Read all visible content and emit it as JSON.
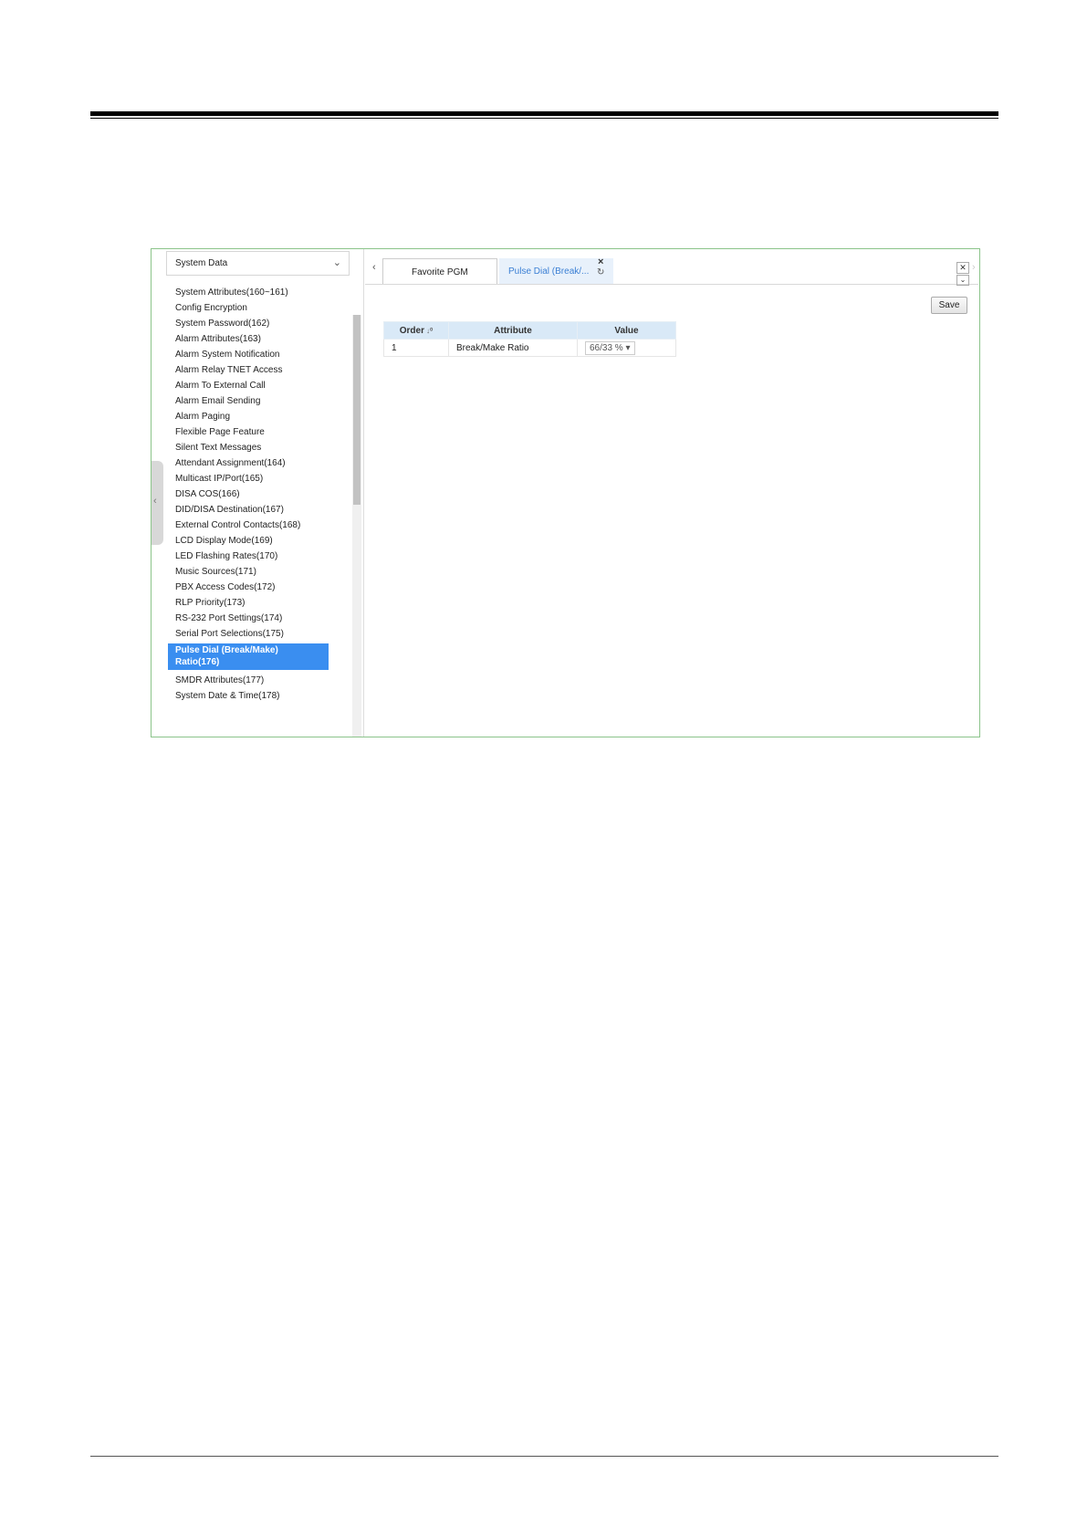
{
  "sidebar": {
    "dropdown_label": "System Data",
    "items": [
      "System Attributes(160~161)",
      "Config Encryption",
      "System Password(162)",
      "Alarm Attributes(163)",
      "Alarm System Notification",
      "Alarm Relay TNET Access",
      "Alarm To External Call",
      "Alarm Email Sending",
      "Alarm Paging",
      "Flexible Page Feature",
      "Silent Text Messages",
      "Attendant Assignment(164)",
      "Multicast IP/Port(165)",
      "DISA COS(166)",
      "DID/DISA Destination(167)",
      "External Control Contacts(168)",
      "LCD Display Mode(169)",
      "LED Flashing Rates(170)",
      "Music Sources(171)",
      "PBX Access Codes(172)",
      "RLP Priority(173)",
      "RS-232 Port Settings(174)",
      "Serial Port Selections(175)"
    ],
    "selected_line1": "Pulse Dial (Break/Make)",
    "selected_line2": "Ratio(176)",
    "after_items": [
      "SMDR Attributes(177)",
      "System Date & Time(178)"
    ]
  },
  "tabs": {
    "first": "Favorite PGM",
    "active": "Pulse Dial (Break/..."
  },
  "toolbar": {
    "save_label": "Save"
  },
  "table": {
    "headers": [
      "Order",
      "Attribute",
      "Value"
    ],
    "rows": [
      {
        "order": "1",
        "attribute": "Break/Make Ratio",
        "value": "66/33 %"
      }
    ]
  }
}
